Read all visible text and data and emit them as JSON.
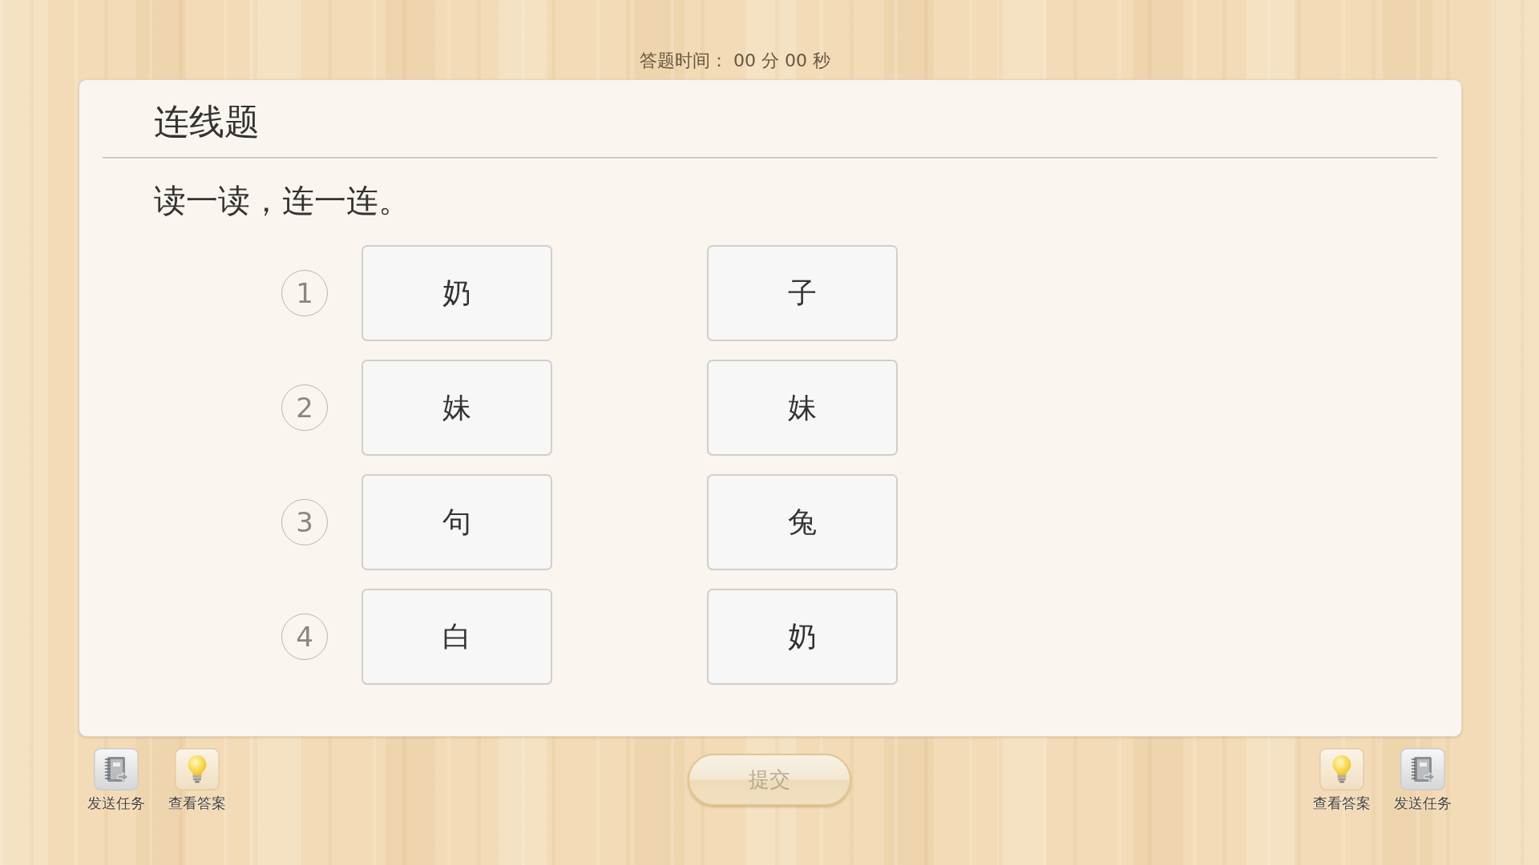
{
  "timer": "答题时间： 00 分 00 秒",
  "question": {
    "type_title": "连线题",
    "instruction": "读一读，连一连。",
    "rows": [
      {
        "number": "1",
        "left": "奶",
        "right": "子"
      },
      {
        "number": "2",
        "left": "妹",
        "right": "妹"
      },
      {
        "number": "3",
        "left": "句",
        "right": "兔"
      },
      {
        "number": "4",
        "left": "白",
        "right": "奶"
      }
    ]
  },
  "toolbar_left": [
    {
      "kind": "send_task",
      "label": "发送任务"
    },
    {
      "kind": "view_answer",
      "label": "查看答案"
    }
  ],
  "submit": {
    "label": "提交",
    "disabled": true
  },
  "toolbar_right": [
    {
      "kind": "view_answer",
      "label": "查看答案"
    },
    {
      "kind": "send_task",
      "label": "发送任务"
    }
  ]
}
